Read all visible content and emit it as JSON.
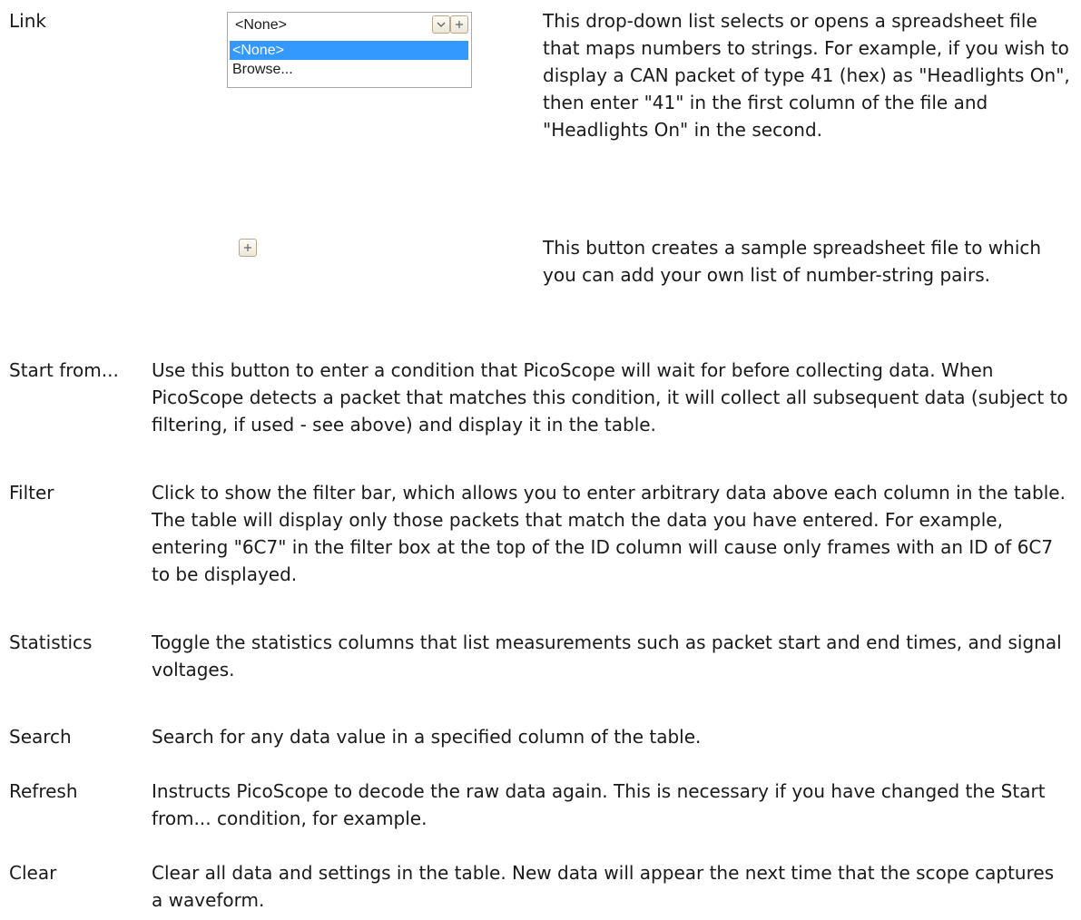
{
  "link": {
    "term": "Link",
    "dropdown": {
      "value": "<None>",
      "options": [
        "<None>",
        "Browse..."
      ]
    },
    "description": "This drop-down list selects or opens a spreadsheet file that maps numbers to strings. For example, if you wish to display a CAN packet of type 41 (hex) as \"Headlights On\", then enter \"41\" in the first column of the file and \"Headlights On\" in the second.",
    "add_button_description": "This button creates a sample spreadsheet file to which you can add your own list of number-string pairs."
  },
  "items": [
    {
      "term": "Start from...",
      "description": "Use this button to enter a condition that PicoScope will wait for before collecting data. When PicoScope detects a packet that matches this condition, it will collect all subsequent data (subject to filtering, if used - see above) and display it in the table."
    },
    {
      "term": "Filter",
      "description": "Click to show the filter bar, which allows you to enter arbitrary data above each column in the table. The table will display only those packets that match the data you have entered. For example, entering \"6C7\" in the filter box at the top of the ID column will cause only frames with an ID of 6C7 to be displayed."
    },
    {
      "term": "Statistics",
      "description": "Toggle the statistics columns that list measurements such as packet start and end times, and signal voltages."
    },
    {
      "term": "Search",
      "description": "Search for any data value in a specified column of the table."
    },
    {
      "term": "Refresh",
      "description": "Instructs PicoScope to decode the raw data again. This is necessary if you have changed the Start from... condition, for example."
    },
    {
      "term": "Clear",
      "description": "Clear all data and settings in the table. New data will appear the next time that the scope captures a waveform."
    }
  ]
}
